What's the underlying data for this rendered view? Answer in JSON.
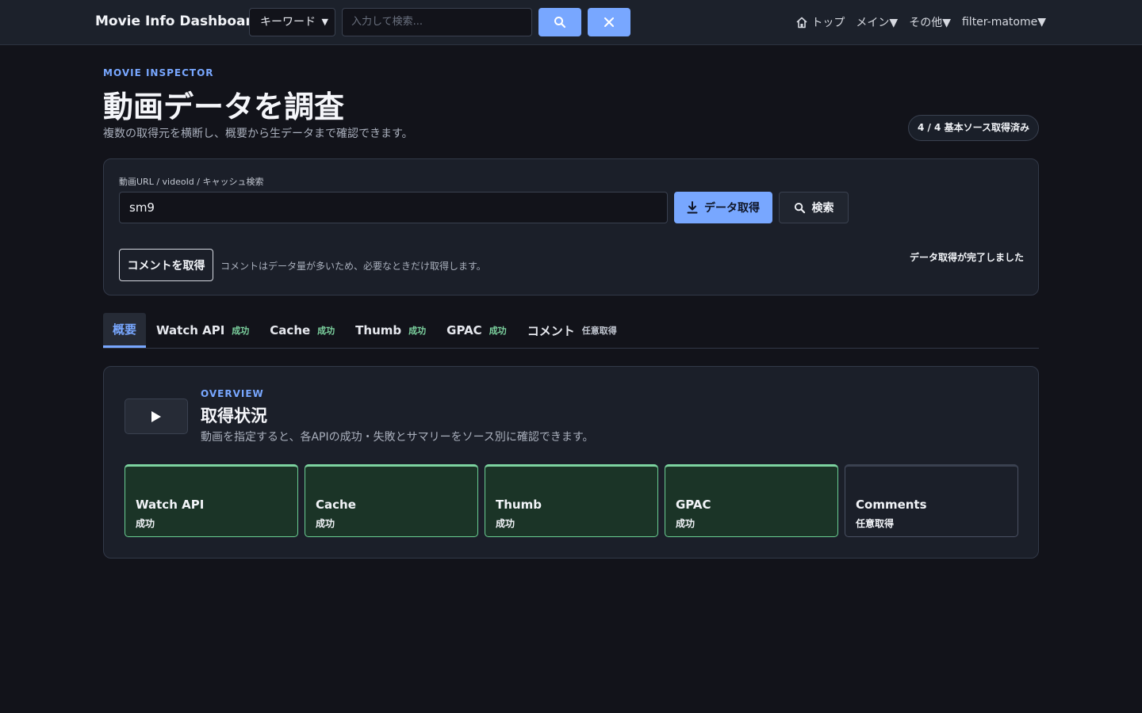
{
  "topbar": {
    "brand": "Movie Info Dashboard",
    "search_type": "キーワード",
    "search_placeholder": "入力して検索...",
    "nav": [
      "トップ",
      "メイン▼",
      "その他▼",
      "filter-matome▼"
    ]
  },
  "header": {
    "eyebrow": "MOVIE INSPECTOR",
    "title": "動画データを調査",
    "subtitle": "複数の取得元を横断し、概要から生データまで確認できます。",
    "status_pill": "4 / 4 基本ソース取得済み"
  },
  "fetch": {
    "label": "動画URL / videoId / キャッシュ検索",
    "value": "sm9",
    "fetch_button": "データ取得",
    "search_button": "検索",
    "comments_button": "コメントを取得",
    "comments_note": "コメントはデータ量が多いため、必要なときだけ取得します。",
    "status": "データ取得が完了しました"
  },
  "tabs": [
    {
      "label": "概要",
      "tag": ""
    },
    {
      "label": "Watch API",
      "tag": "成功"
    },
    {
      "label": "Cache",
      "tag": "成功"
    },
    {
      "label": "Thumb",
      "tag": "成功"
    },
    {
      "label": "GPAC",
      "tag": "成功"
    },
    {
      "label": "コメント",
      "tag": "任意取得"
    }
  ],
  "overview": {
    "eyebrow": "OVERVIEW",
    "title": "取得状況",
    "subtitle": "動画を指定すると、各APIの成功・失敗とサマリーをソース別に確認できます。",
    "sources": [
      {
        "name": "Watch API",
        "state": "成功"
      },
      {
        "name": "Cache",
        "state": "成功"
      },
      {
        "name": "Thumb",
        "state": "成功"
      },
      {
        "name": "GPAC",
        "state": "成功"
      },
      {
        "name": "Comments",
        "state": "任意取得"
      }
    ]
  },
  "colors": {
    "accent": "#78a7ff",
    "success": "#7dd3a0",
    "background": "#12131a"
  }
}
